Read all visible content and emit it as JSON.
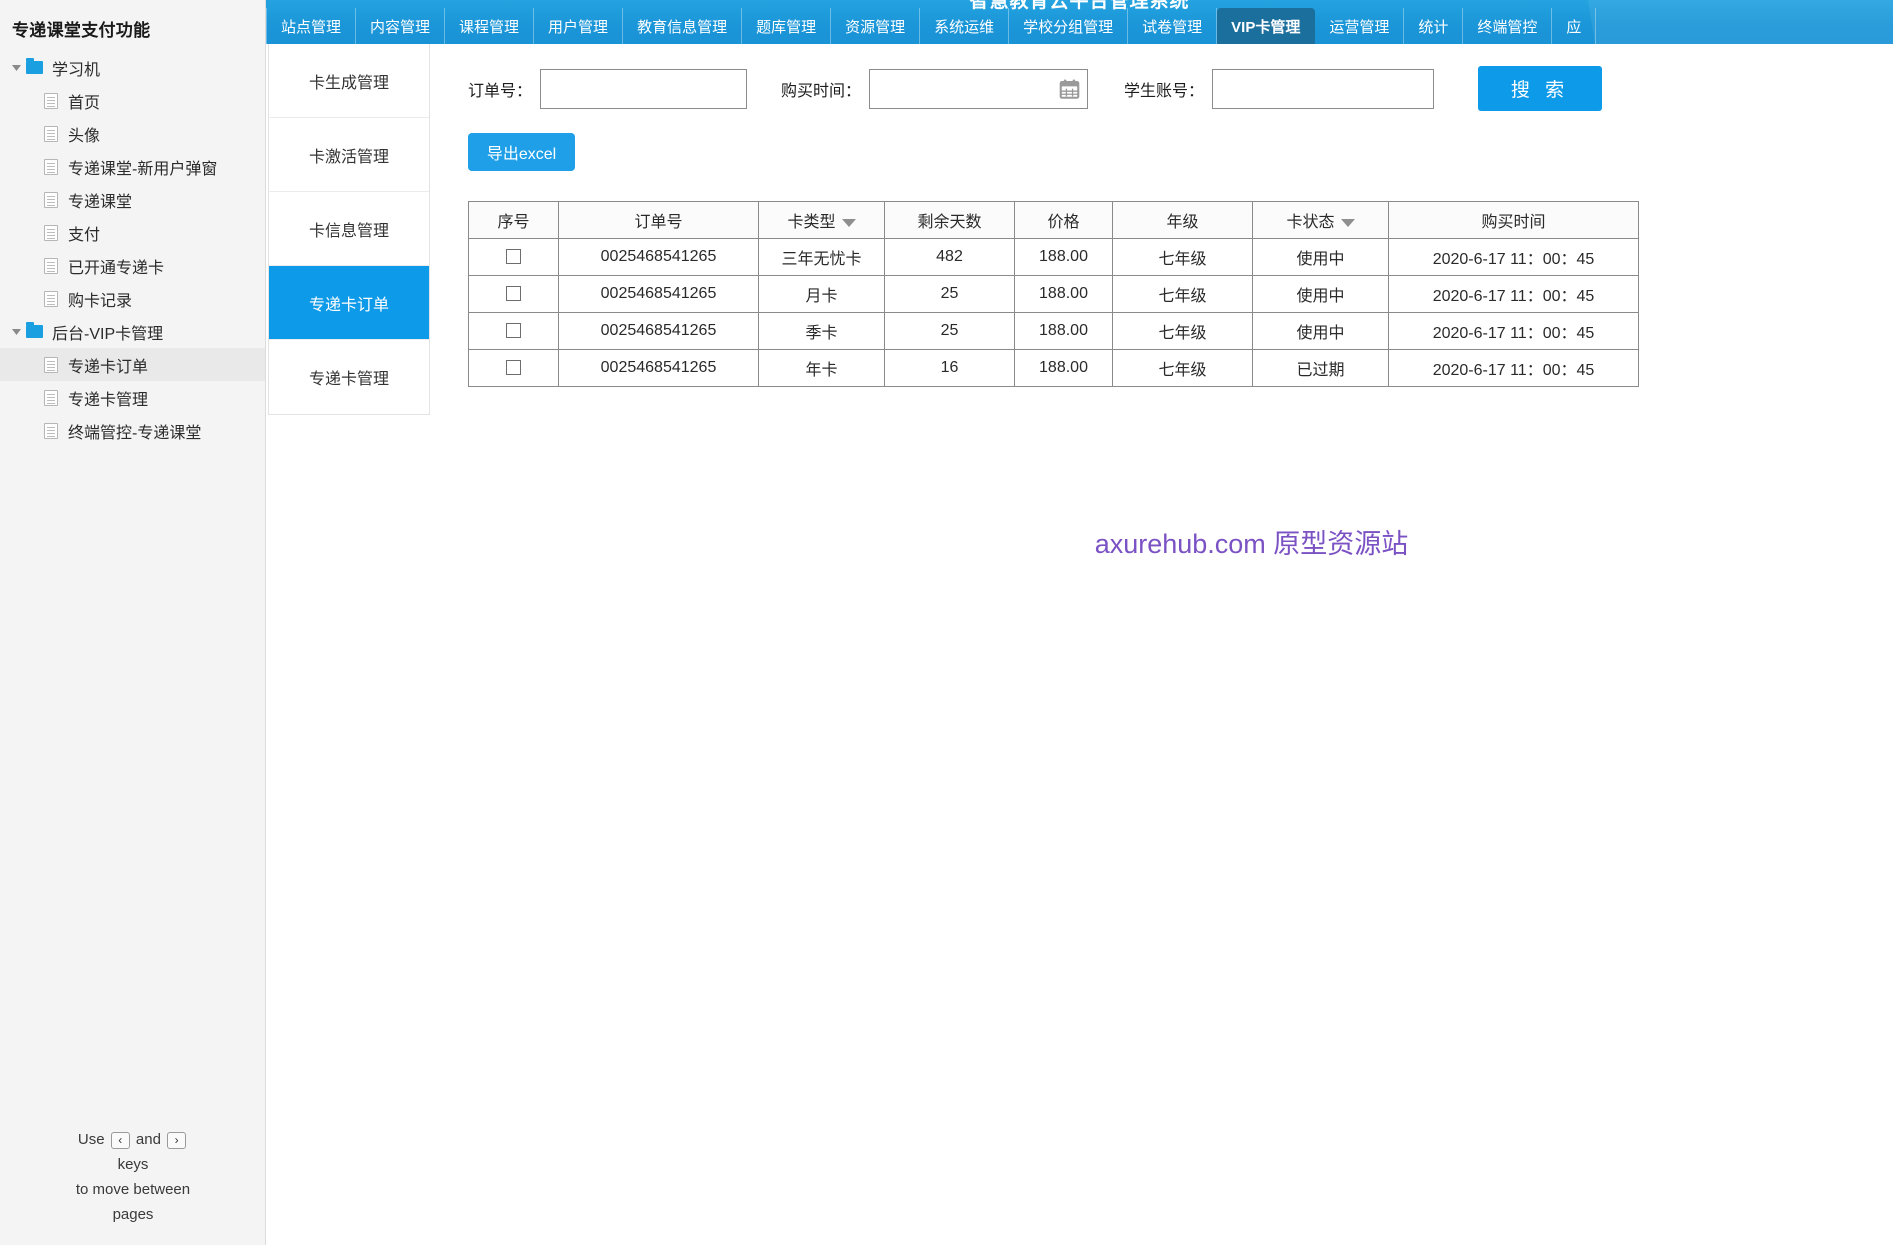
{
  "sitemap": {
    "title": "专递课堂支付功能",
    "nodes": [
      {
        "label": "学习机",
        "type": "folder",
        "level": 1,
        "expanded": true,
        "selected": false
      },
      {
        "label": "首页",
        "type": "page",
        "level": 2,
        "selected": false
      },
      {
        "label": "头像",
        "type": "page",
        "level": 2,
        "selected": false
      },
      {
        "label": "专递课堂-新用户弹窗",
        "type": "page",
        "level": 2,
        "selected": false
      },
      {
        "label": "专递课堂",
        "type": "page",
        "level": 2,
        "selected": false
      },
      {
        "label": "支付",
        "type": "page",
        "level": 2,
        "selected": false
      },
      {
        "label": "已开通专递卡",
        "type": "page",
        "level": 2,
        "selected": false
      },
      {
        "label": "购卡记录",
        "type": "page",
        "level": 2,
        "selected": false
      },
      {
        "label": "后台-VIP卡管理",
        "type": "folder",
        "level": 1,
        "expanded": true,
        "selected": false
      },
      {
        "label": "专递卡订单",
        "type": "page",
        "level": 2,
        "selected": true
      },
      {
        "label": "专递卡管理",
        "type": "page",
        "level": 2,
        "selected": false
      },
      {
        "label": "终端管控-专递课堂",
        "type": "page",
        "level": 2,
        "selected": false
      }
    ],
    "footer": {
      "line1_a": "Use",
      "key_prev": "‹",
      "line1_b": "and",
      "key_next": "›",
      "line2": "keys",
      "line3": "to move between",
      "line4": "pages"
    }
  },
  "header": {
    "brand": "智慧教育云平台管理系统",
    "nav": [
      {
        "label": "站点管理",
        "active": false
      },
      {
        "label": "内容管理",
        "active": false
      },
      {
        "label": "课程管理",
        "active": false
      },
      {
        "label": "用户管理",
        "active": false
      },
      {
        "label": "教育信息管理",
        "active": false
      },
      {
        "label": "题库管理",
        "active": false
      },
      {
        "label": "资源管理",
        "active": false
      },
      {
        "label": "系统运维",
        "active": false
      },
      {
        "label": "学校分组管理",
        "active": false
      },
      {
        "label": "试卷管理",
        "active": false
      },
      {
        "label": "VIP卡管理",
        "active": true
      },
      {
        "label": "运营管理",
        "active": false
      },
      {
        "label": "统计",
        "active": false
      },
      {
        "label": "终端管控",
        "active": false
      },
      {
        "label": "应",
        "active": false
      }
    ]
  },
  "subnav": {
    "items": [
      {
        "label": "卡生成管理",
        "active": false
      },
      {
        "label": "卡激活管理",
        "active": false
      },
      {
        "label": "卡信息管理",
        "active": false
      },
      {
        "label": "专递卡订单",
        "active": true
      },
      {
        "label": "专递卡管理",
        "active": false
      }
    ]
  },
  "search": {
    "order_label": "订单号：",
    "order_value": "",
    "time_label": "购买时间：",
    "time_value": "",
    "account_label": "学生账号：",
    "account_value": "",
    "search_button": "搜 索",
    "export_button": "导出excel"
  },
  "table": {
    "columns": [
      {
        "key": "index",
        "label": "序号",
        "sortable": false
      },
      {
        "key": "order_no",
        "label": "订单号",
        "sortable": false
      },
      {
        "key": "card_type",
        "label": "卡类型",
        "sortable": true
      },
      {
        "key": "days_left",
        "label": "剩余天数",
        "sortable": false
      },
      {
        "key": "price",
        "label": "价格",
        "sortable": false
      },
      {
        "key": "grade",
        "label": "年级",
        "sortable": false
      },
      {
        "key": "status",
        "label": "卡状态",
        "sortable": true
      },
      {
        "key": "buy_time",
        "label": "购买时间",
        "sortable": false
      }
    ],
    "rows": [
      {
        "checked": false,
        "order_no": "0025468541265",
        "card_type": "三年无忧卡",
        "days_left": "482",
        "price": "188.00",
        "grade": "七年级",
        "status": "使用中",
        "buy_time": "2020-6-17 11：00：45"
      },
      {
        "checked": false,
        "order_no": "0025468541265",
        "card_type": "月卡",
        "days_left": "25",
        "price": "188.00",
        "grade": "七年级",
        "status": "使用中",
        "buy_time": "2020-6-17 11：00：45"
      },
      {
        "checked": false,
        "order_no": "0025468541265",
        "card_type": "季卡",
        "days_left": "25",
        "price": "188.00",
        "grade": "七年级",
        "status": "使用中",
        "buy_time": "2020-6-17 11：00：45"
      },
      {
        "checked": false,
        "order_no": "0025468541265",
        "card_type": "年卡",
        "days_left": "16",
        "price": "188.00",
        "grade": "七年级",
        "status": "已过期",
        "buy_time": "2020-6-17 11：00：45"
      }
    ]
  },
  "watermark": {
    "text": "axurehub.com 原型资源站",
    "color": "#7b52c4"
  },
  "colors": {
    "brand_blue": "#1a93d6",
    "active_tab": "#1b6f9c",
    "accent": "#0d9ae8",
    "sidebar_bg": "#f4f4f4"
  }
}
